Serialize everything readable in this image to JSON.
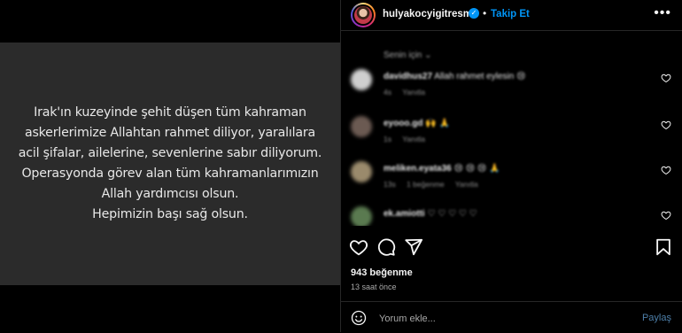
{
  "post": {
    "text": "Irak'ın kuzeyinde şehit düşen tüm kahraman\naskerlerimize Allahtan rahmet diliyor, yaralılara\nacil şifalar, ailelerine, sevenlerine sabır diliyorum.\nOperasyonda görev alan tüm kahramanlarımızın\nAllah yardımcısı olsun.\nHepimizin başı sağ olsun."
  },
  "header": {
    "username": "hulyakocyigitresmi",
    "verified_icon": "verified-badge-icon",
    "separator": "•",
    "follow_label": "Takip Et",
    "more_label": "•••"
  },
  "comments": {
    "section_label": "Senin için",
    "items": [
      {
        "username": "davidhus27",
        "text": "Allah rahmet eylesin",
        "emoji": "😢",
        "meta": [
          "4s",
          "Yanıtla"
        ],
        "avatar_color": "#cfcfcf"
      },
      {
        "username": "eyooo.gd",
        "text": "",
        "emoji": "🙌 🙏",
        "meta": [
          "1s",
          "Yanıtla"
        ],
        "avatar_color": "#6b5a52"
      },
      {
        "username": "meliken.eyata36",
        "text": "",
        "emoji": "😢 😢 😢 🙏",
        "meta": [
          "13s",
          "1 beğenme",
          "Yanıtla"
        ],
        "avatar_color": "#9a8a6c"
      },
      {
        "username": "ek.amiotti",
        "text": "",
        "emoji": "♡ ♡ ♡ ♡ ♡",
        "meta": [],
        "avatar_color": "#5a7a50"
      }
    ]
  },
  "actions": {
    "like_icon": "heart-icon",
    "comment_icon": "comment-icon",
    "share_icon": "share-icon",
    "save_icon": "bookmark-icon"
  },
  "stats": {
    "likes": "943 beğenme",
    "time_ago": "13 saat önce"
  },
  "compose": {
    "emoji_icon": "emoji-icon",
    "placeholder": "Yorum ekle...",
    "post_label": "Paylaş"
  },
  "colors": {
    "accent": "#0095f6",
    "background": "#000000",
    "image_card": "#2b2b2b",
    "secondary_text": "#a8a8a8",
    "post_button": "#4d7fa9"
  }
}
